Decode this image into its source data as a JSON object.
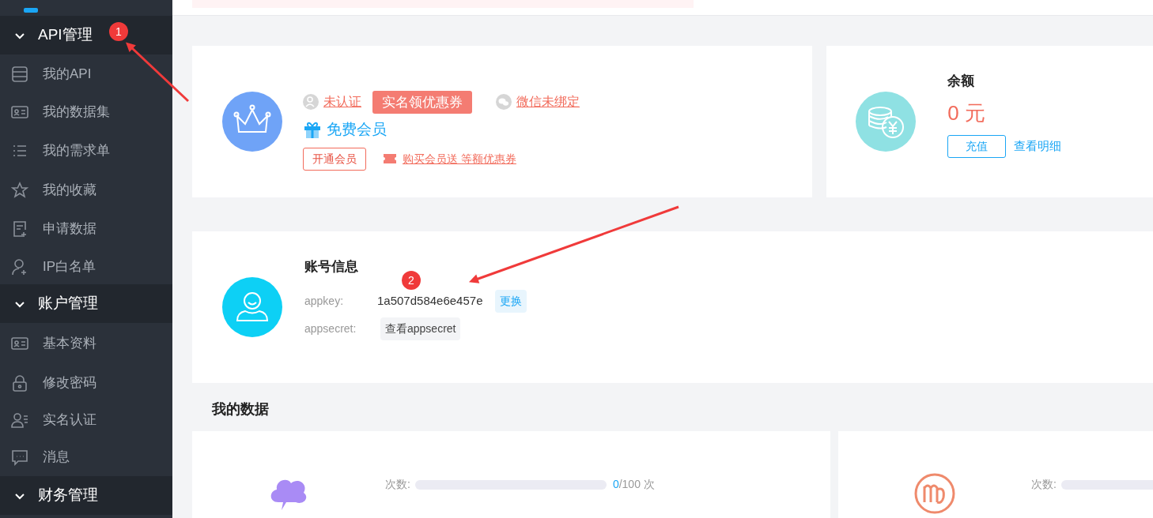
{
  "sidebar": {
    "groups": [
      {
        "title": "API管理",
        "expanded": true,
        "items": [
          {
            "label": "我的API"
          },
          {
            "label": "我的数据集"
          },
          {
            "label": "我的需求单"
          },
          {
            "label": "我的收藏"
          },
          {
            "label": "申请数据"
          },
          {
            "label": "IP白名单"
          }
        ]
      },
      {
        "title": "账户管理",
        "expanded": true,
        "items": [
          {
            "label": "基本资料"
          },
          {
            "label": "修改密码"
          },
          {
            "label": "实名认证"
          },
          {
            "label": "消息"
          }
        ]
      },
      {
        "title": "财务管理",
        "expanded": true
      }
    ]
  },
  "profile": {
    "verify_status": "未认证",
    "verify_promo": "实名领优惠券",
    "wechat_status": "微信未绑定",
    "membership": "免费会员",
    "open_button": "开通会员",
    "promo_link": "购买会员送 等额优惠券"
  },
  "balance": {
    "title": "余额",
    "amount": "0 元",
    "recharge_button": "充值",
    "details_link": "查看明细"
  },
  "account": {
    "title": "账号信息",
    "fields": [
      {
        "label": "appkey:",
        "value": "1a507d584e6e457e",
        "action": "更换",
        "kind": "value"
      },
      {
        "label": "appsecret:",
        "action": "查看appsecret",
        "kind": "hidden"
      }
    ]
  },
  "my_data": {
    "title": "我的数据",
    "items": [
      {
        "count_label": "次数:",
        "used": "0",
        "total": "/100 次",
        "level": 0
      },
      {
        "count_label": "次数:",
        "level": 0
      }
    ]
  },
  "annotations": [
    {
      "label": "1"
    },
    {
      "label": "2"
    }
  ]
}
